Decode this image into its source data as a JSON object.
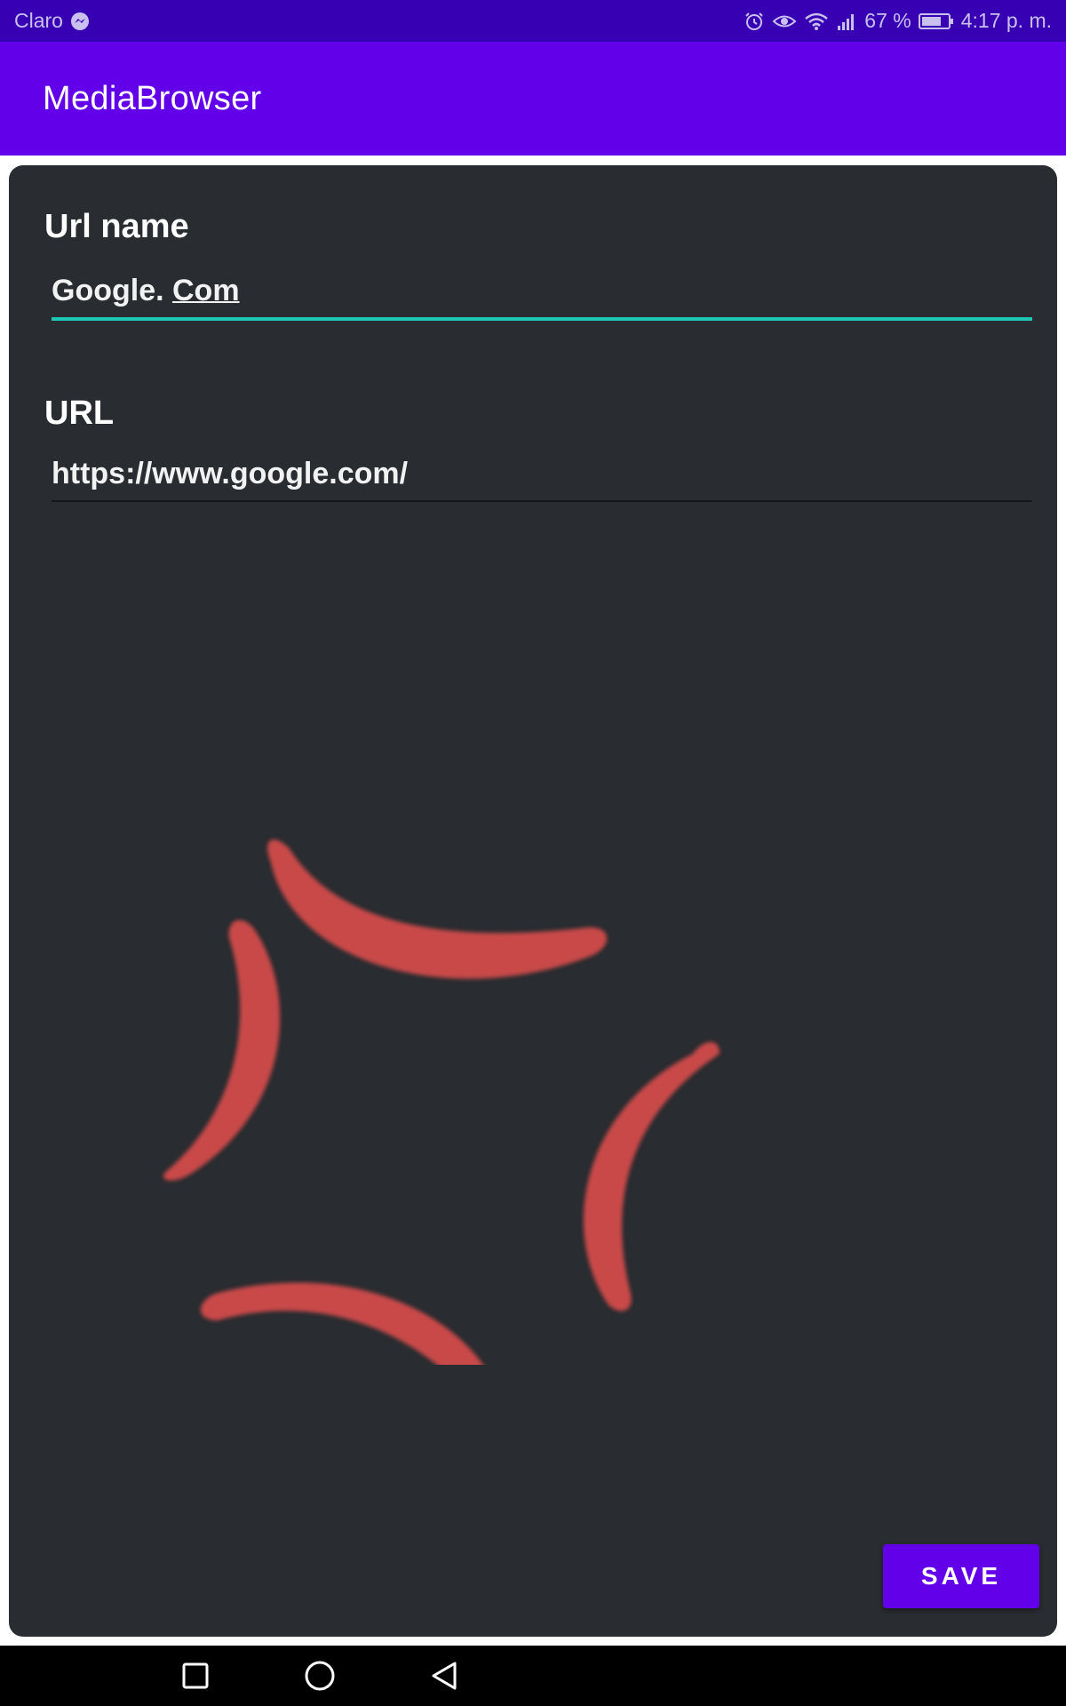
{
  "status_bar": {
    "carrier": "Claro",
    "battery_percent": "67 %",
    "time": "4:17 p. m."
  },
  "app_bar": {
    "title": "MediaBrowser"
  },
  "form": {
    "url_name_label": "Url name",
    "url_name_value_part1": "Google. ",
    "url_name_value_part2": "Com",
    "url_label": "URL",
    "url_value": "https://www.google.com/"
  },
  "actions": {
    "save_label": "SAVE"
  },
  "colors": {
    "status_bar": "#3700b3",
    "app_bar": "#6200ea",
    "card": "#292c30",
    "accent_teal": "#1ec8b6",
    "graphic_red": "#c94a4a"
  },
  "icons": [
    "messenger-icon",
    "alarm-icon",
    "eye-icon",
    "wifi-icon",
    "signal-icon",
    "battery-icon",
    "recents-icon",
    "home-icon",
    "back-icon",
    "anger-symbol-icon"
  ]
}
